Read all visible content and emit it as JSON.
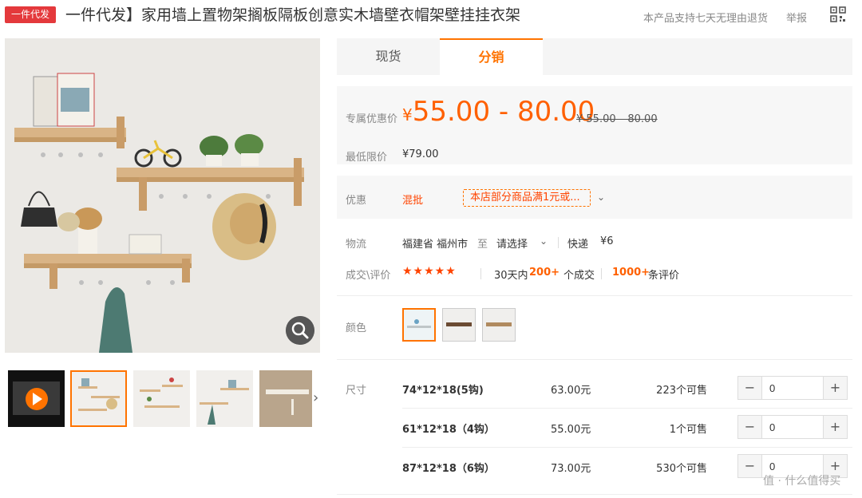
{
  "header": {
    "badge": "一件代发",
    "title": "一件代发】家用墙上置物架搁板隔板创意实木墙壁衣帽架壁挂挂衣架",
    "return_note": "本产品支持七天无理由退货",
    "report": "举报",
    "qr_icon": "qr-code-icon"
  },
  "tabs": [
    {
      "label": "现货",
      "active": false
    },
    {
      "label": "分销",
      "active": true
    }
  ],
  "price": {
    "label": "专属优惠价",
    "currency": "¥",
    "range": "55.00 - 80.00",
    "original": "¥ 55.00 – 80.00",
    "min_label": "最低限价",
    "min_value": "¥79.00"
  },
  "promo": {
    "label": "优惠",
    "tag": "混批",
    "text": "本店部分商品满1元或...",
    "chevron": "chevron-down-icon"
  },
  "logistics": {
    "label": "物流",
    "from": "福建省 福州市",
    "to_word": "至",
    "select": "请选择",
    "express": "快递",
    "fee": "¥6"
  },
  "reviews": {
    "label": "成交\\评价",
    "stars": "★★★★★",
    "period": "30天内",
    "sold_count": "200+",
    "sold_suffix": "个成交",
    "review_count": "1000+",
    "review_suffix": "条评价"
  },
  "color": {
    "label": "颜色",
    "swatches": [
      "white-shelf",
      "brown-shelf",
      "wood-shelf"
    ],
    "selected": 0
  },
  "sizes": {
    "label": "尺寸",
    "rows": [
      {
        "name": "74*12*18(5钩)",
        "price": "63.00元",
        "stock": "223个可售",
        "qty": "0"
      },
      {
        "name": "61*12*18（4钩）",
        "price": "55.00元",
        "stock": "1个可售",
        "qty": "0"
      },
      {
        "name": "87*12*18（6钩）",
        "price": "73.00元",
        "stock": "530个可售",
        "qty": "0"
      }
    ]
  },
  "gallery": {
    "zoom_icon": "magnifier-icon",
    "video_icon": "play-icon",
    "next_icon": "chevron-right-icon",
    "thumb_count": 5
  },
  "watermark": "值 · 什么值得买",
  "colors": {
    "accent": "#ff7300",
    "price": "#ff6000",
    "badge": "#e4393c"
  }
}
